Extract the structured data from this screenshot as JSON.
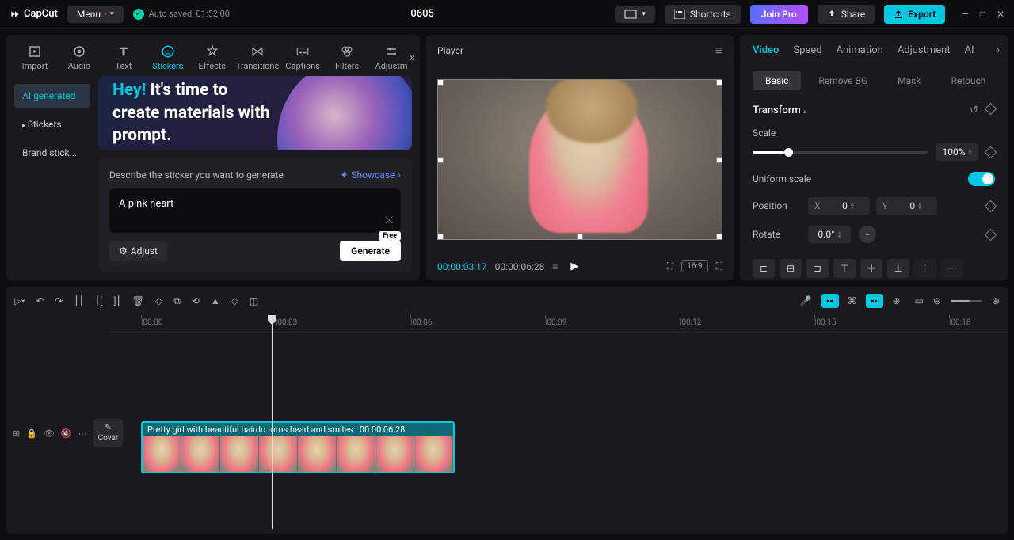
{
  "app": {
    "name": "CapCut"
  },
  "topbar": {
    "menu": "Menu",
    "autosave": "Auto saved: 01:52:00",
    "project": "0605",
    "shortcuts": "Shortcuts",
    "joinPro": "Join Pro",
    "share": "Share",
    "export": "Export"
  },
  "mediaTabs": {
    "import": "Import",
    "audio": "Audio",
    "text": "Text",
    "stickers": "Stickers",
    "effects": "Effects",
    "transitions": "Transitions",
    "captions": "Captions",
    "filters": "Filters",
    "adjustm": "Adjustm"
  },
  "subTabs": {
    "ai": "AI generated",
    "stickers": "Stickers",
    "brand": "Brand stick..."
  },
  "promo": {
    "hey": "Hey!",
    "text": " It's time to create materials with prompt."
  },
  "prompt": {
    "label": "Describe the sticker you want to generate",
    "showcase": "Showcase",
    "value": "A pink heart",
    "adjust": "Adjust",
    "free": "Free",
    "generate": "Generate"
  },
  "player": {
    "title": "Player",
    "currentTime": "00:00:03:17",
    "totalTime": "00:00:06:28",
    "ratio": "16:9"
  },
  "inspector": {
    "tabs": {
      "video": "Video",
      "speed": "Speed",
      "animation": "Animation",
      "adjustment": "Adjustment",
      "ai": "AI"
    },
    "subTabs": {
      "basic": "Basic",
      "removeBg": "Remove BG",
      "mask": "Mask",
      "retouch": "Retouch"
    },
    "transform": "Transform",
    "scale": {
      "label": "Scale",
      "value": "100%"
    },
    "uniform": "Uniform scale",
    "position": {
      "label": "Position",
      "x": "X",
      "xVal": "0",
      "y": "Y",
      "yVal": "0"
    },
    "rotate": {
      "label": "Rotate",
      "value": "0.0°"
    }
  },
  "timeline": {
    "ticks": [
      "00:00",
      "00:03",
      "00:06",
      "00:09",
      "00:12",
      "00:15",
      "00:18"
    ],
    "cover": "Cover",
    "clip": {
      "name": "Pretty girl with beautiful hairdo turns head and smiles",
      "duration": "00:00:06:28"
    }
  }
}
